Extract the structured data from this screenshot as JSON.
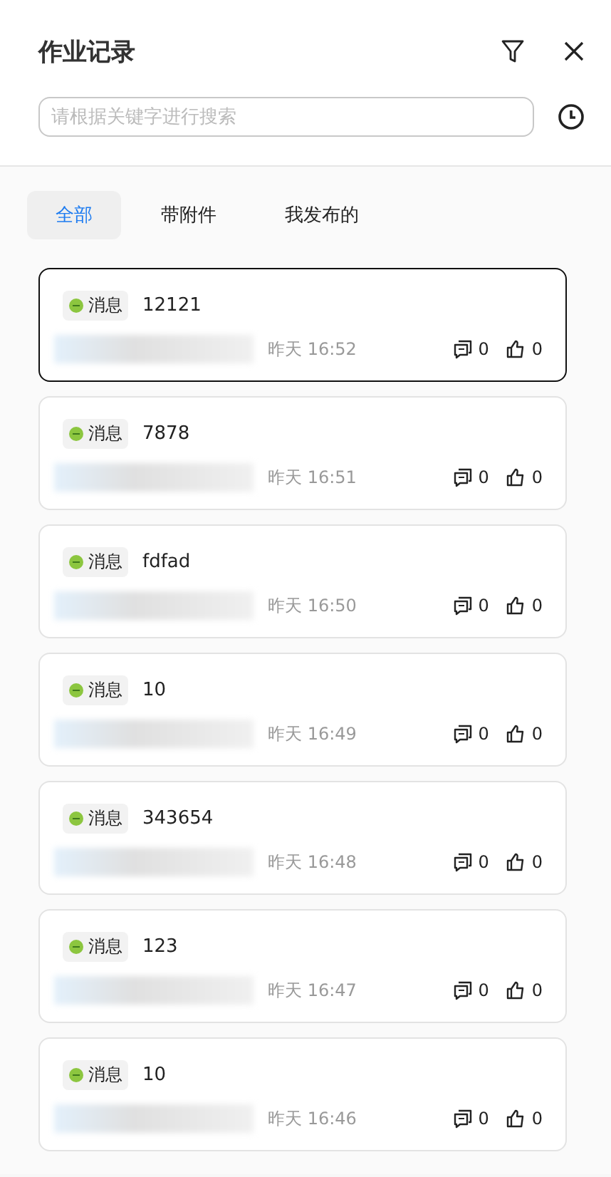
{
  "header": {
    "title": "作业记录"
  },
  "search": {
    "placeholder": "请根据关键字进行搜索"
  },
  "tabs": [
    {
      "label": "全部",
      "selected": true
    },
    {
      "label": "带附件",
      "selected": false
    },
    {
      "label": "我发布的",
      "selected": false
    }
  ],
  "records": [
    {
      "tag": "消息",
      "title": "12121",
      "time": "昨天 16:52",
      "comments": "0",
      "likes": "0",
      "selected": true
    },
    {
      "tag": "消息",
      "title": "7878",
      "time": "昨天 16:51",
      "comments": "0",
      "likes": "0",
      "selected": false
    },
    {
      "tag": "消息",
      "title": "fdfad",
      "time": "昨天 16:50",
      "comments": "0",
      "likes": "0",
      "selected": false
    },
    {
      "tag": "消息",
      "title": "10",
      "time": "昨天 16:49",
      "comments": "0",
      "likes": "0",
      "selected": false
    },
    {
      "tag": "消息",
      "title": "343654",
      "time": "昨天 16:48",
      "comments": "0",
      "likes": "0",
      "selected": false
    },
    {
      "tag": "消息",
      "title": "123",
      "time": "昨天 16:47",
      "comments": "0",
      "likes": "0",
      "selected": false
    },
    {
      "tag": "消息",
      "title": "10",
      "time": "昨天 16:46",
      "comments": "0",
      "likes": "0",
      "selected": false
    }
  ]
}
